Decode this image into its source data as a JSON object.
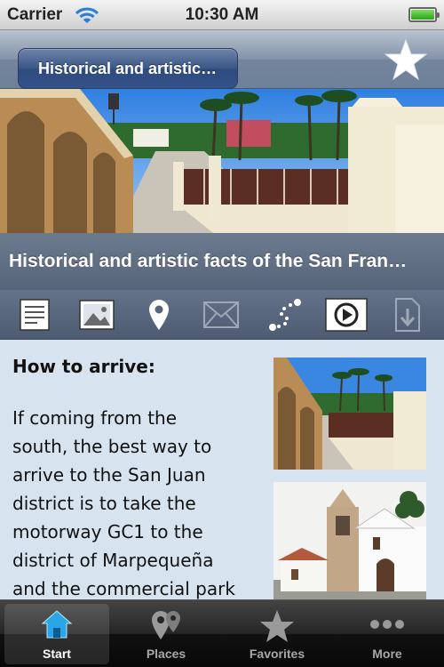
{
  "status": {
    "carrier": "Carrier",
    "time": "10:30 AM"
  },
  "nav": {
    "back_label": "Historical and artistic…",
    "favorite_icon": "star-icon"
  },
  "page": {
    "title": "Historical and artistic facts of the San Fran…"
  },
  "toolbar": {
    "icons": [
      "text-icon",
      "image-icon",
      "location-pin-icon",
      "mail-icon",
      "route-icon",
      "video-icon",
      "download-icon"
    ]
  },
  "content": {
    "heading": "How to arrive:",
    "lines": [
      "If coming from the",
      "south, the best way to",
      "arrive to the San Juan",
      "district is to take the",
      "motorway GC1 to the",
      "district of Marpequeña",
      "and the commercial park"
    ]
  },
  "tabs": [
    {
      "label": "Start",
      "icon": "home-icon",
      "active": true
    },
    {
      "label": "Places",
      "icon": "places-icon",
      "active": false
    },
    {
      "label": "Favorites",
      "icon": "star-icon",
      "active": false
    },
    {
      "label": "More",
      "icon": "more-icon",
      "active": false
    }
  ],
  "colors": {
    "content_bg": "#d7e4f0",
    "nav_accent": "#34528a",
    "active_tab": "#2aa6e8"
  }
}
